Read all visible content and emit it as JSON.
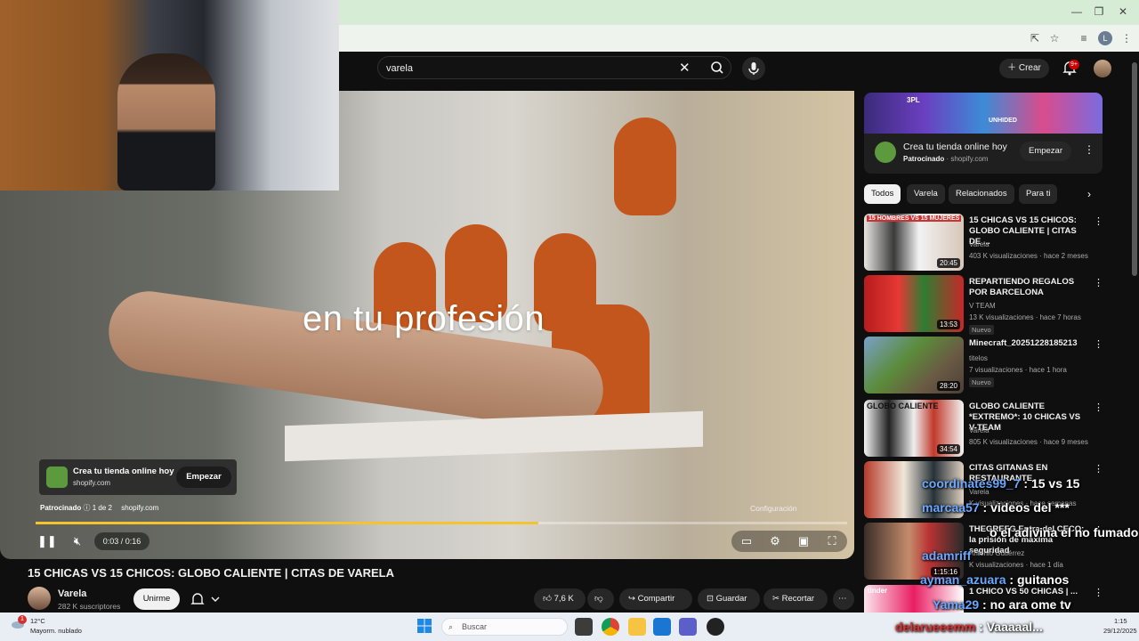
{
  "search": {
    "value": "varela"
  },
  "header": {
    "create_label": "Crear",
    "notif_badge": "9+",
    "profile_initial": "L"
  },
  "video": {
    "caption": "en tu profesión",
    "title": "15 CHICAS VS 15 CHICOS: GLOBO CALIENTE | CITAS DE VARELA",
    "time": "0:03 / 0:16",
    "progress": 0.62,
    "tooltip": "Configuración"
  },
  "ad_overlay": {
    "title": "Crea tu tienda online hoy",
    "domain": "shopify.com",
    "cta": "Empezar",
    "sponsor": "Patrocinado",
    "count": "1 de 2",
    "sponsor_domain": "shopify.com"
  },
  "channel": {
    "name": "Varela",
    "subs": "282 K suscriptores",
    "join": "Unirme"
  },
  "actions": {
    "likes": "7,6 K",
    "share": "Compartir",
    "save": "Guardar",
    "clip": "Recortar"
  },
  "sidebar_ad": {
    "title": "Crea tu tienda online hoy",
    "sponsored": "Patrocinado",
    "domain": "shopify.com",
    "cta": "Empezar",
    "banner_texts": [
      "3PL",
      "UNHIDED"
    ]
  },
  "chips": [
    "Todos",
    "Varela",
    "Relacionados",
    "Para ti"
  ],
  "recs": [
    {
      "title": "15 CHICAS VS 15 CHICOS: GLOBO CALIENTE | CITAS DE ...",
      "channel": "Varela",
      "meta": "403 K visualizaciones · hace 2 meses",
      "duration": "20:45",
      "thumb_text": "15 HOMBRES VS 15 MUJERES",
      "badge": ""
    },
    {
      "title": "REPARTIENDO REGALOS POR BARCELONA",
      "channel": "V TEAM",
      "meta": "13 K visualizaciones · hace 7 horas",
      "duration": "13:53",
      "thumb_text": "",
      "badge": "Nuevo"
    },
    {
      "title": "Minecraft_20251228185213",
      "channel": "titelos",
      "meta": "7 visualizaciones · hace 1 hora",
      "duration": "28:20",
      "thumb_text": "",
      "badge": "Nuevo"
    },
    {
      "title": "GLOBO CALIENTE *EXTREMO*: 10 CHICAS VS V-TEAM",
      "channel": "Varela",
      "meta": "805 K visualizaciones · hace 9 meses",
      "duration": "34:54",
      "thumb_text": "GLOBO CALIENTE",
      "badge": ""
    },
    {
      "title": "CITAS GITANAS EN RESTAURANTE",
      "channel": "Varela",
      "meta": "K visualizaciones · hace semanas",
      "duration": "",
      "thumb_text": "",
      "badge": ""
    },
    {
      "title": "THEGREFG Entra del CECO: la prisión de máxima seguridad",
      "channel": "Antonio Gutiérrez",
      "meta": "K visualizaciones · hace 1 día",
      "duration": "1:15:16",
      "thumb_text": "",
      "badge": ""
    },
    {
      "title": "1 CHICO VS 50 CHICAS | ...",
      "channel": "",
      "meta": "",
      "duration": "",
      "thumb_text": "tinder",
      "badge": ""
    }
  ],
  "chat": [
    {
      "user": "coordinates99_7",
      "msg": "15 vs 15"
    },
    {
      "user": "marcaa57",
      "msg": "videos del ***"
    },
    {
      "user": "",
      "msg": "o el adivina el no fumado"
    },
    {
      "user": "adamriff",
      "msg": ""
    },
    {
      "user": "ayman_azuara",
      "msg": "guitanos"
    },
    {
      "user": "Yama29",
      "msg": "no ara ome tv"
    }
  ],
  "bottom_chat": {
    "user": "delarueeemm",
    "msg": "Vaaaaal..."
  },
  "taskbar": {
    "weather_temp": "12°C",
    "weather_desc": "Mayorm. nublado",
    "search": "Buscar",
    "time": "1:15",
    "date": "29/12/2025",
    "notif": "1"
  },
  "colors": {
    "accent": "#f4c430",
    "yt_bg": "#0f0f0f",
    "chip_bg": "#272727",
    "shopify_green": "#5d9a3e"
  }
}
